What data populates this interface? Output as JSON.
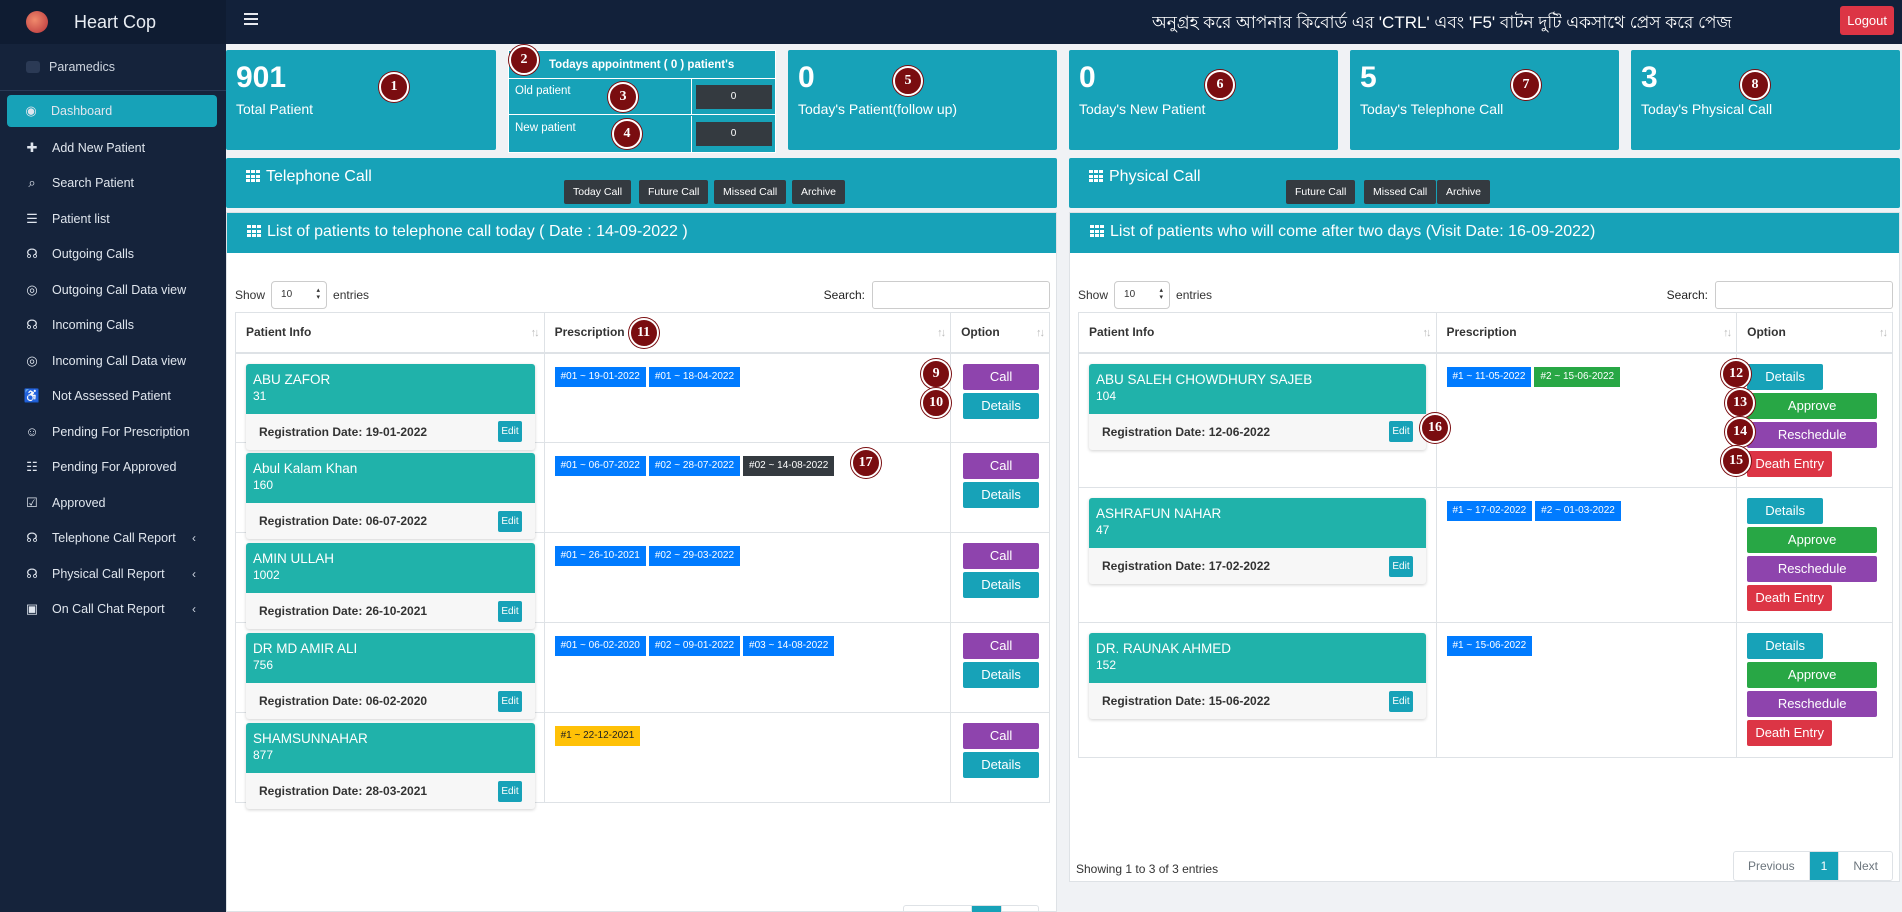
{
  "app": {
    "name": "Heart Cop",
    "role": "Paramedics",
    "notice": "অনুগ্রহ করে আপনার কিবোর্ড এর 'CTRL' এবং 'F5' বাটন দুটি একসাথে প্রেস করে পেজ",
    "logout": "Logout"
  },
  "sidebar": {
    "items": [
      {
        "label": "Dashboard",
        "icon": "dashboard-icon"
      },
      {
        "label": "Add New Patient",
        "icon": "add-user-icon"
      },
      {
        "label": "Search Patient",
        "icon": "search-icon"
      },
      {
        "label": "Patient list",
        "icon": "list-icon"
      },
      {
        "label": "Outgoing Calls",
        "icon": "headset-icon"
      },
      {
        "label": "Outgoing Call Data view",
        "icon": "eye-icon"
      },
      {
        "label": "Incoming Calls",
        "icon": "headset-icon"
      },
      {
        "label": "Incoming Call Data view",
        "icon": "eye-icon"
      },
      {
        "label": "Not Assessed Patient",
        "icon": "wheelchair-icon"
      },
      {
        "label": "Pending For Prescription",
        "icon": "user-clock-icon"
      },
      {
        "label": "Pending For Approved",
        "icon": "users-icon"
      },
      {
        "label": "Approved",
        "icon": "calendar-check-icon"
      },
      {
        "label": "Telephone Call Report",
        "icon": "headset-icon"
      },
      {
        "label": "Physical Call Report",
        "icon": "headset-icon"
      },
      {
        "label": "On Call Chat Report",
        "icon": "chat-icon"
      }
    ]
  },
  "stats": {
    "total": {
      "num": "901",
      "label": "Total Patient",
      "marker": "1"
    },
    "appointment": {
      "title": "Todays appointment ( 0 ) patient's",
      "marker": "2",
      "old_label": "Old patient",
      "old_value": "0",
      "old_marker": "3",
      "new_label": "New patient",
      "new_value": "0",
      "new_marker": "4"
    },
    "followup": {
      "num": "0",
      "label": "Today's Patient(follow up)",
      "marker": "5"
    },
    "new": {
      "num": "0",
      "label": "Today's New Patient",
      "marker": "6"
    },
    "tel": {
      "num": "5",
      "label": "Today's Telephone Call",
      "marker": "7"
    },
    "phys": {
      "num": "3",
      "label": "Today's Physical Call",
      "marker": "8"
    }
  },
  "telephone": {
    "bar_title": "Telephone Call",
    "buttons": [
      "Today Call",
      "Future Call",
      "Missed Call",
      "Archive"
    ],
    "list_title": "List of patients to telephone call today ( Date : 14-09-2022 )",
    "show": "Show",
    "entries": "entries",
    "entries_value": "10",
    "search": "Search:",
    "col_info": "Patient Info",
    "col_rx": "Prescription",
    "col_opt": "Option",
    "rx_marker": "11",
    "call_marker": "9",
    "details_marker": "10",
    "rx3_marker": "17",
    "reg_prefix": "Registration Date: ",
    "edit": "Edit",
    "call": "Call",
    "details": "Details",
    "rows": [
      {
        "name": "ABU ZAFOR",
        "id": "31",
        "reg": "19-01-2022",
        "rx": [
          [
            "#01 ~ 19-01-2022",
            "b"
          ],
          [
            "#01 ~ 18-04-2022",
            "b"
          ]
        ]
      },
      {
        "name": "Abul Kalam Khan",
        "id": "160",
        "reg": "06-07-2022",
        "rx": [
          [
            "#01 ~ 06-07-2022",
            "b"
          ],
          [
            "#02 ~ 28-07-2022",
            "b"
          ],
          [
            "#02 ~ 14-08-2022",
            "d"
          ]
        ]
      },
      {
        "name": "AMIN ULLAH",
        "id": "1002",
        "reg": "26-10-2021",
        "rx": [
          [
            "#01 ~ 26-10-2021",
            "b"
          ],
          [
            "#02 ~ 29-03-2022",
            "b"
          ]
        ]
      },
      {
        "name": "DR MD AMIR ALI",
        "id": "756",
        "reg": "06-02-2020",
        "rx": [
          [
            "#01 ~ 06-02-2020",
            "b"
          ],
          [
            "#02 ~ 09-01-2022",
            "b"
          ],
          [
            "#03 ~ 14-08-2022",
            "b"
          ]
        ]
      },
      {
        "name": "SHAMSUNNAHAR",
        "id": "877",
        "reg": "28-03-2021",
        "rx": [
          [
            "#1 ~ 22-12-2021",
            "y"
          ]
        ]
      }
    ]
  },
  "physical": {
    "bar_title": "Physical Call",
    "buttons": [
      "Future Call",
      "Missed Call",
      "Archive"
    ],
    "list_title": "List of patients who will come after two days (Visit Date: 16-09-2022)",
    "show": "Show",
    "entries": "entries",
    "entries_value": "10",
    "search": "Search:",
    "col_info": "Patient Info",
    "col_rx": "Prescription",
    "col_opt": "Option",
    "details_marker": "12",
    "approve_marker": "13",
    "reschedule_marker": "14",
    "death_marker": "15",
    "edit_marker": "16",
    "reg_prefix": "Registration Date: ",
    "edit": "Edit",
    "details": "Details",
    "approve": "Approve",
    "reschedule": "Reschedule",
    "death": "Death Entry",
    "rows": [
      {
        "name": "ABU SALEH CHOWDHURY SAJEB",
        "id": "104",
        "reg": "12-06-2022",
        "rx": [
          [
            "#1 ~ 11-05-2022",
            "b"
          ],
          [
            "#2 ~ 15-06-2022",
            "g"
          ]
        ]
      },
      {
        "name": "ASHRAFUN NAHAR",
        "id": "47",
        "reg": "17-02-2022",
        "rx": [
          [
            "#1 ~ 17-02-2022",
            "b"
          ],
          [
            "#2 ~ 01-03-2022",
            "b"
          ]
        ]
      },
      {
        "name": "DR. RAUNAK AHMED",
        "id": "152",
        "reg": "15-06-2022",
        "rx": [
          [
            "#1 ~ 15-06-2022",
            "b"
          ]
        ]
      }
    ],
    "showing": "Showing 1 to 3 of 3 entries",
    "pager": [
      "Previous",
      "1",
      "Next"
    ]
  }
}
